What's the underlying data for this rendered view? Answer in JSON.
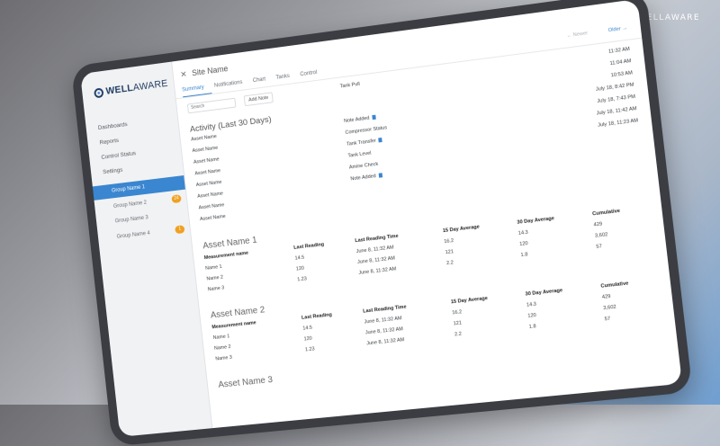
{
  "project_label": "PROJECT: WELLAWARE",
  "logo": {
    "bold": "WELL",
    "thin": "AWARE"
  },
  "sidebar": {
    "nav": [
      {
        "label": "Dashboards"
      },
      {
        "label": "Reports"
      },
      {
        "label": "Control Status"
      },
      {
        "label": "Settings"
      }
    ],
    "groups": [
      {
        "label": "Group Name 1",
        "badge": "",
        "active": true
      },
      {
        "label": "Group Name 2",
        "badge": "24",
        "active": false
      },
      {
        "label": "Group Name 3",
        "badge": "",
        "active": false
      },
      {
        "label": "Group Name 4",
        "badge": "1",
        "active": false
      }
    ]
  },
  "header": {
    "title": "Site Name"
  },
  "tabs": [
    {
      "label": "Summary",
      "active": true
    },
    {
      "label": "Notifications"
    },
    {
      "label": "Chart"
    },
    {
      "label": "Tanks"
    },
    {
      "label": "Control"
    }
  ],
  "pager": {
    "newer": "← Newer",
    "older": "Older →"
  },
  "toolbar": {
    "search_placeholder": "Search",
    "add_note": "Add Note"
  },
  "activity": {
    "title": "Activity (Last 30 Days)",
    "assets": [
      "Asset Name",
      "Asset Name",
      "Asset Name",
      "Asset Name",
      "Asset Name",
      "Asset Name",
      "Asset Name",
      "Asset Name"
    ],
    "events": [
      {
        "label": "Tank Pull",
        "note": false
      },
      {
        "label": "",
        "note": false
      },
      {
        "label": "",
        "note": false
      },
      {
        "label": "Note Added",
        "note": true
      },
      {
        "label": "Compressor Status",
        "note": false
      },
      {
        "label": "Tank Transfer",
        "note": true
      },
      {
        "label": "Tank Level",
        "note": false
      },
      {
        "label": "Amine Check",
        "note": false
      },
      {
        "label": "Note Added",
        "note": true
      }
    ],
    "times": [
      "11:32 AM",
      "11:04 AM",
      "10:53 AM",
      "July 18, 8:42 PM",
      "July 18, 7:43 PM",
      "July 18, 11:42 AM",
      "July 18, 11:23 AM"
    ]
  },
  "assets": [
    {
      "title": "Asset Name 1",
      "headers": [
        "Measurement name",
        "Last Reading",
        "Last Reading Time",
        "15 Day Average",
        "30 Day Average",
        "Cumulative"
      ],
      "rows": [
        [
          "Name 1",
          "14.5",
          "June 8, 11:32 AM",
          "16.2",
          "14.3",
          "429"
        ],
        [
          "Name 2",
          "120",
          "June 8, 11:32 AM",
          "121",
          "120",
          "3,602"
        ],
        [
          "Name 3",
          "1.23",
          "June 8, 11:32 AM",
          "2.2",
          "1.8",
          "57"
        ]
      ]
    },
    {
      "title": "Asset Name 2",
      "headers": [
        "Measurement name",
        "Last Reading",
        "Last Reading Time",
        "15 Day Average",
        "30 Day Average",
        "Cumulative"
      ],
      "rows": [
        [
          "Name 1",
          "14.5",
          "June 8, 11:32 AM",
          "16.2",
          "14.3",
          "429"
        ],
        [
          "Name 2",
          "120",
          "June 8, 11:32 AM",
          "121",
          "120",
          "3,602"
        ],
        [
          "Name 3",
          "1.23",
          "June 8, 11:32 AM",
          "2.2",
          "1.8",
          "57"
        ]
      ]
    }
  ],
  "asset3_title": "Asset Name 3"
}
